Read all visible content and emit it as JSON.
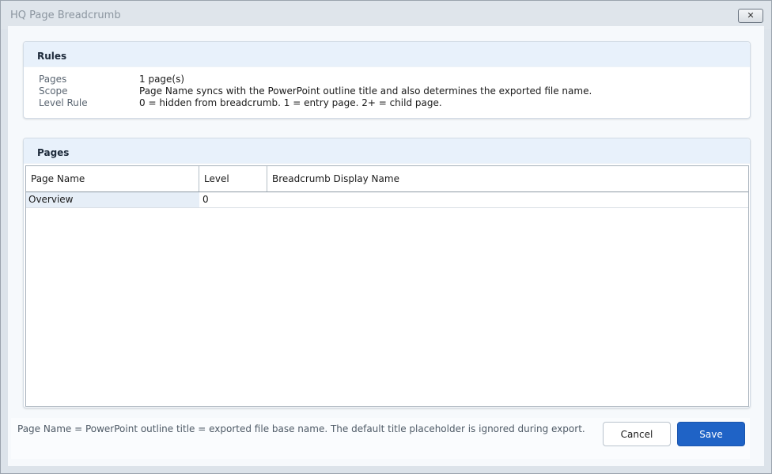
{
  "window": {
    "title": "HQ Page Breadcrumb",
    "close_label": "✕"
  },
  "rules": {
    "header": "Rules",
    "items": [
      {
        "label": "Pages",
        "value": "1 page(s)"
      },
      {
        "label": "Scope",
        "value": "Page Name syncs with the PowerPoint outline title and also determines the exported file name."
      },
      {
        "label": "Level Rule",
        "value": "0 = hidden from breadcrumb. 1 = entry page. 2+ = child page."
      }
    ]
  },
  "pages": {
    "header": "Pages",
    "columns": [
      "Page Name",
      "Level",
      "Breadcrumb Display Name"
    ],
    "rows": [
      {
        "page_name": "Overview",
        "level": "0",
        "breadcrumb_display_name": ""
      }
    ]
  },
  "footer": {
    "note": "Page Name = PowerPoint outline title = exported file base name. The default title placeholder is ignored during export.",
    "cancel_label": "Cancel",
    "save_label": "Save"
  },
  "colors": {
    "accent": "#1f63c6",
    "header_band": "#e8f1fb",
    "selected_cell": "#e6eef7"
  }
}
